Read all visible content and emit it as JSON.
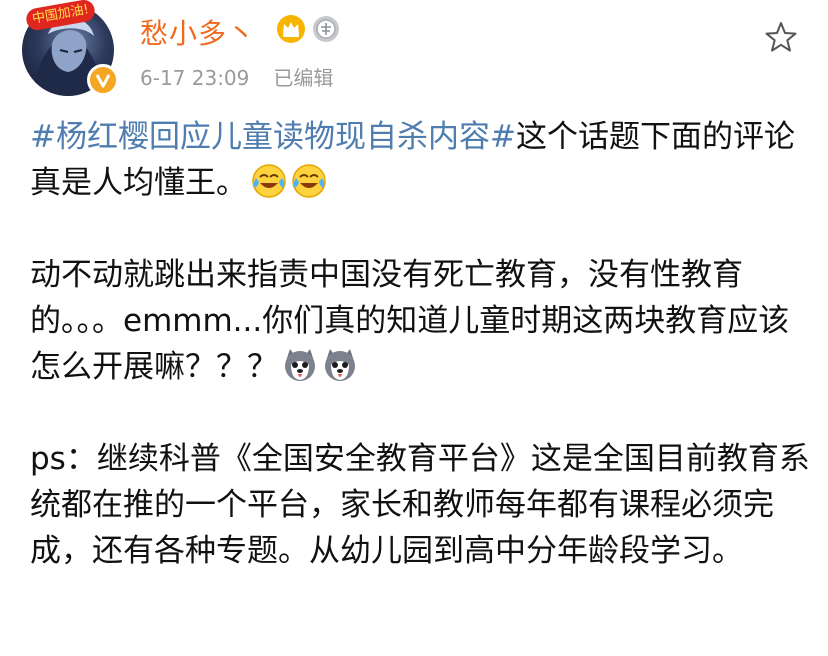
{
  "user": {
    "name": "愁小多丶",
    "avatar_badge": "中国加油!",
    "timestamp": "6-17 23:09",
    "edited_label": "已编辑"
  },
  "icons": {
    "crown": "crown-icon",
    "medal": "medal-icon",
    "favorite": "star-icon",
    "verified": "verified-badge-icon",
    "emoji_laugh_cry": "laugh-cry-emoji",
    "emoji_husky": "husky-emoji"
  },
  "colors": {
    "username": "#f06a1e",
    "topic_link": "#507daf",
    "meta_text": "#9a9a9a",
    "body_text": "#111111"
  },
  "post": {
    "topic": "#杨红樱回应儿童读物现自杀内容#",
    "p1_after_topic": "这个话题下面的评论真是人均懂王。",
    "p2": "动不动就跳出来指责中国没有死亡教育，没有性教育的。。。emmm...你们真的知道儿童时期这两块教育应该怎么开展嘛？？？",
    "p3": "ps：继续科普《全国安全教育平台》这是全国目前教育系统都在推的一个平台，家长和教师每年都有课程必须完成，还有各种专题。从幼儿园到高中分年龄段学习。"
  }
}
